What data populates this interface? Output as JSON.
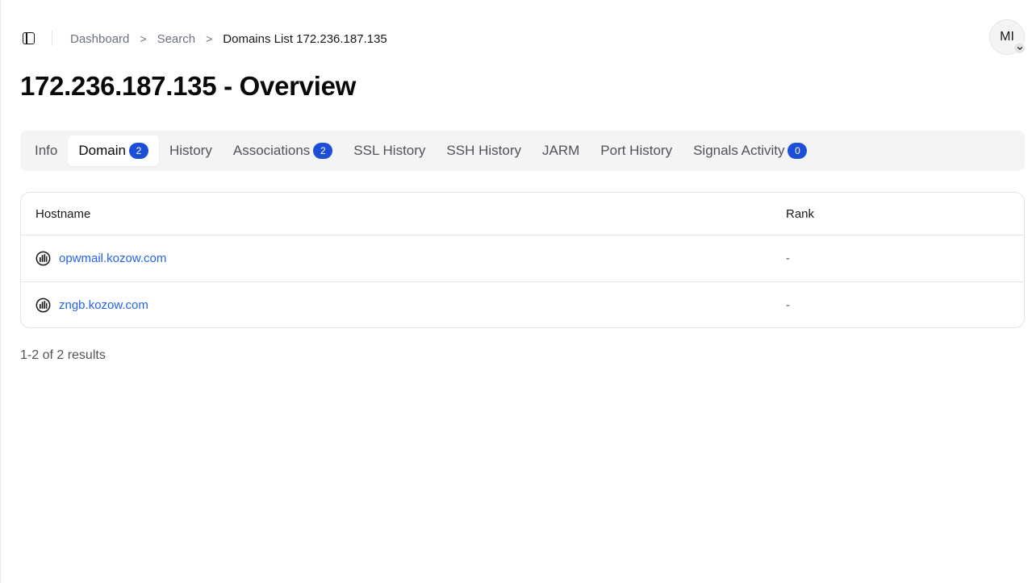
{
  "breadcrumb": {
    "items": [
      "Dashboard",
      "Search"
    ],
    "separator": ">",
    "current": "Domains List 172.236.187.135"
  },
  "user": {
    "initials": "MI"
  },
  "page": {
    "title": "172.236.187.135 - Overview"
  },
  "tabs": [
    {
      "label": "Info",
      "badge": null,
      "active": false
    },
    {
      "label": "Domain",
      "badge": "2",
      "active": true
    },
    {
      "label": "History",
      "badge": null,
      "active": false
    },
    {
      "label": "Associations",
      "badge": "2",
      "active": false
    },
    {
      "label": "SSL History",
      "badge": null,
      "active": false
    },
    {
      "label": "SSH History",
      "badge": null,
      "active": false
    },
    {
      "label": "JARM",
      "badge": null,
      "active": false
    },
    {
      "label": "Port History",
      "badge": null,
      "active": false
    },
    {
      "label": "Signals Activity",
      "badge": "0",
      "active": false
    }
  ],
  "table": {
    "columns": {
      "hostname": "Hostname",
      "rank": "Rank"
    },
    "rows": [
      {
        "hostname": "opwmail.kozow.com",
        "rank": "-",
        "icon": "domain-favicon-icon"
      },
      {
        "hostname": "zngb.kozow.com",
        "rank": "-",
        "icon": "domain-favicon-icon"
      }
    ]
  },
  "pagination": {
    "summary": "1-2 of 2 results"
  },
  "colors": {
    "accent": "#1d4ed8",
    "link": "#2563eb",
    "tab_bg": "#f4f4f5",
    "border": "#e4e4e7"
  }
}
